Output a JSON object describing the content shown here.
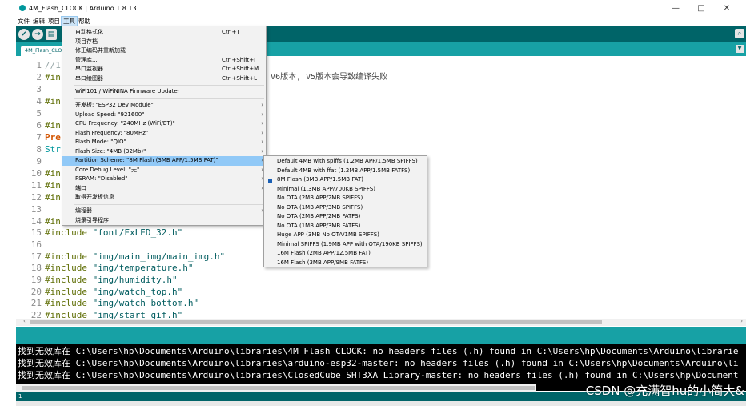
{
  "window": {
    "title": "4M_Flash_CLOCK | Arduino 1.8.13",
    "controls": [
      "—",
      "□",
      "✕"
    ]
  },
  "menubar": [
    "文件",
    "编辑",
    "项目",
    "工具",
    "帮助"
  ],
  "toolbar": {
    "verify_icon": "✔",
    "upload_icon": "→",
    "new_icon": "▤",
    "serial_icon": "⌕"
  },
  "tab": {
    "label": "4M_Flash_CLOCK",
    "menu_icon": "▼"
  },
  "tools_menu": {
    "items": [
      {
        "label": "自动格式化",
        "shortcut": "Ctrl+T"
      },
      {
        "label": "项目存档",
        "shortcut": ""
      },
      {
        "label": "修正编码并重新加载",
        "shortcut": ""
      },
      {
        "label": "管理库...",
        "shortcut": "Ctrl+Shift+I"
      },
      {
        "label": "串口监视器",
        "shortcut": "Ctrl+Shift+M"
      },
      {
        "label": "串口绘图器",
        "shortcut": "Ctrl+Shift+L"
      },
      {
        "label": "WiFi101 / WiFiNINA Firmware Updater",
        "shortcut": ""
      },
      {
        "label": "开发板: \"ESP32 Dev Module\"",
        "shortcut": "",
        "submenu": true
      },
      {
        "label": "Upload Speed: \"921600\"",
        "shortcut": "",
        "submenu": true
      },
      {
        "label": "CPU Frequency: \"240MHz (WiFi/BT)\"",
        "shortcut": "",
        "submenu": true
      },
      {
        "label": "Flash Frequency: \"80MHz\"",
        "shortcut": "",
        "submenu": true
      },
      {
        "label": "Flash Mode: \"QIO\"",
        "shortcut": "",
        "submenu": true
      },
      {
        "label": "Flash Size: \"4MB (32Mb)\"",
        "shortcut": "",
        "submenu": true
      },
      {
        "label": "Partition Scheme: \"8M Flash (3MB APP/1.5MB FAT)\"",
        "shortcut": "",
        "submenu": true,
        "highlighted": true
      },
      {
        "label": "Core Debug Level: \"无\"",
        "shortcut": "",
        "submenu": true
      },
      {
        "label": "PSRAM: \"Disabled\"",
        "shortcut": "",
        "submenu": true
      },
      {
        "label": "端口",
        "shortcut": "",
        "submenu": true
      },
      {
        "label": "取得开发板信息",
        "shortcut": ""
      },
      {
        "label": "编程器",
        "shortcut": "",
        "submenu": true
      },
      {
        "label": "烧录引导程序",
        "shortcut": ""
      }
    ],
    "arrow": "›"
  },
  "partition_submenu": {
    "items": [
      "Default 4MB with spiffs (1.2MB APP/1.5MB SPIFFS)",
      "Default 4MB with ffat (1.2MB APP/1.5MB FATFS)",
      "8M Flash (3MB APP/1.5MB FAT)",
      "Minimal (1.3MB APP/700KB SPIFFS)",
      "No OTA (2MB APP/2MB SPIFFS)",
      "No OTA (1MB APP/3MB SPIFFS)",
      "No OTA (2MB APP/2MB FATFS)",
      "No OTA (1MB APP/3MB FATFS)",
      "Huge APP (3MB No OTA/1MB SPIFFS)",
      "Minimal SPIFFS (1.9MB APP with OTA/190KB SPIFFS)",
      "16M Flash (2MB APP/12.5MB FAT)",
      "16M Flash (3MB APP/9MB FATFS)"
    ],
    "selected_index": 2
  },
  "editor": {
    "lines": [
      {
        "n": "1",
        "text": "//1"
      },
      {
        "n": "2",
        "text": "#in",
        "tail": "on V6版本, V5版本会导致编译失败"
      },
      {
        "n": "3",
        "text": ""
      },
      {
        "n": "4",
        "text": "#in"
      },
      {
        "n": "5",
        "text": ""
      },
      {
        "n": "6",
        "text": "#in"
      },
      {
        "n": "7",
        "text": "Pre"
      },
      {
        "n": "8",
        "text": "Str"
      },
      {
        "n": "9",
        "text": ""
      },
      {
        "n": "10",
        "text": "#in"
      },
      {
        "n": "11",
        "text": "#in"
      },
      {
        "n": "12",
        "text": "#in"
      },
      {
        "n": "13",
        "text": ""
      },
      {
        "n": "14",
        "text": "#in"
      },
      {
        "n": "15",
        "text": "#include",
        "str": "\"font/FxLED_32.h\""
      },
      {
        "n": "16",
        "text": ""
      },
      {
        "n": "17",
        "text": "#include",
        "str": "\"img/main_img/main_img.h\""
      },
      {
        "n": "18",
        "text": "#include",
        "str": "\"img/temperature.h\""
      },
      {
        "n": "19",
        "text": "#include",
        "str": "\"img/humidity.h\""
      },
      {
        "n": "20",
        "text": "#include",
        "str": "\"img/watch_top.h\""
      },
      {
        "n": "21",
        "text": "#include",
        "str": "\"img/watch_bottom.h\""
      },
      {
        "n": "22",
        "text": "#include",
        "str": "\"img/start_gif.h\""
      }
    ],
    "scroll_left": "‹",
    "scroll_right": "›"
  },
  "console": {
    "lines": [
      "找到无效库在 C:\\Users\\hp\\Documents\\Arduino\\libraries\\4M_Flash_CLOCK: no headers files (.h) found in C:\\Users\\hp\\Documents\\Arduino\\librarie",
      "找到无效库在 C:\\Users\\hp\\Documents\\Arduino\\libraries\\arduino-esp32-master: no headers files (.h) found in C:\\Users\\hp\\Documents\\Arduino\\li",
      "找到无效库在 C:\\Users\\hp\\Documents\\Arduino\\libraries\\ClosedCube_SHT3XA_Library-master: no headers files (.h) found in C:\\Users\\hp\\Document"
    ]
  },
  "bottom": {
    "line_number": "1",
    "watermark": "CSDN @充满智hu的小简大&"
  },
  "colors": {
    "toolbar": "#006468",
    "tabs": "#17a1a5",
    "highlight": "#91c9f7"
  }
}
